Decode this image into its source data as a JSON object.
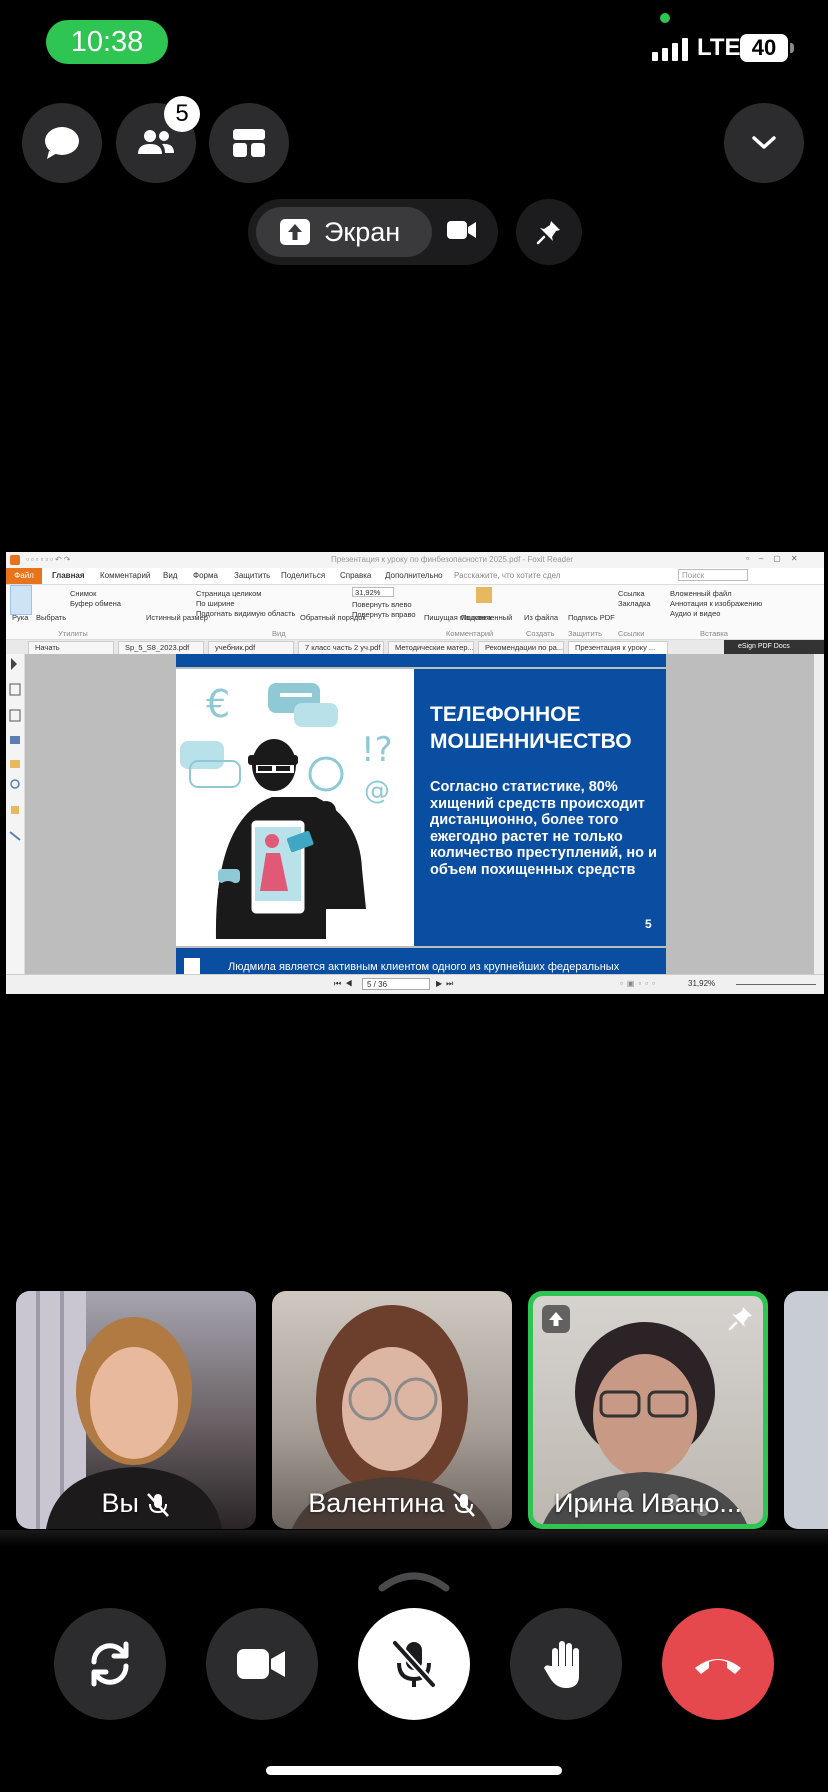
{
  "status_bar": {
    "time": "10:38",
    "network": "LTE",
    "battery": "40"
  },
  "top_controls": {
    "participants_badge": "5",
    "screen_label": "Экран"
  },
  "foxit": {
    "title": "Презентация к уроку по финбезопасности 2025.pdf - Foxit Reader",
    "search_hint": "Расскажите, что хотите сдел",
    "search_placeholder": "Поиск",
    "menu": [
      "Файл",
      "Главная",
      "Комментарий",
      "Вид",
      "Форма",
      "Защитить",
      "Поделиться",
      "Справка",
      "Дополнительно"
    ],
    "ribbon": {
      "hand": "Рука",
      "select": "Выбрать",
      "snapshot": "Снимок",
      "clipboard": "Буфер обмена",
      "actual_size": "Истинный размер",
      "fit_page": "Страница целиком",
      "fit_width": "По ширине",
      "fit_visible": "Подогнать видимую область",
      "reverse_order": "Обратный порядок",
      "zoom_value": "31,92%",
      "rotate_left": "Повернуть влево",
      "rotate_right": "Повернуть вправо",
      "typewriter": "Пишущая машинка",
      "highlight": "Подсвеченный",
      "from_file": "Из файла",
      "sign_pdf": "Подпись PDF",
      "link": "Ссылка",
      "bookmark": "Закладка",
      "attached_file": "Вложенный файл",
      "image_annotation": "Аннотация к изображению",
      "audio_video": "Аудио и видео",
      "group_utilities": "Утилиты",
      "group_view": "Вид",
      "group_comment": "Комментарий",
      "group_create": "Создать",
      "group_protect": "Защитить",
      "group_links": "Ссылки",
      "group_insert": "Вставка"
    },
    "tabs": [
      "Начать",
      "Sp_5_S8_2023.pdf",
      "учебник.pdf",
      "7 класс часть 2 уч.pdf",
      "Методические матер...",
      "Рекомендации по ра...",
      "Презентация к уроку ..."
    ],
    "esign": "eSign PDF Docs",
    "slide": {
      "title": "ТЕЛЕФОННОЕ МОШЕННИЧЕСТВО",
      "text": "Согласно статистике, 80% хищений средств происходит дистанционно, более того ежегодно растет не только количество преступлений, но и объем похищенных средств",
      "number": "5",
      "next_text": "Людмила является активным клиентом одного из крупнейших федеральных"
    },
    "page_indicator": "5 / 36",
    "status_zoom": "31,92%"
  },
  "participants": [
    {
      "name": "Вы",
      "muted": true
    },
    {
      "name": "Валентина",
      "muted": true
    },
    {
      "name": "Ирина Ивано...",
      "speaking": true
    }
  ],
  "colors": {
    "accent_green": "#2ec552",
    "hangup_red": "#e5484d",
    "slide_blue": "#0a4ea1",
    "foxit_orange": "#e8731a"
  }
}
